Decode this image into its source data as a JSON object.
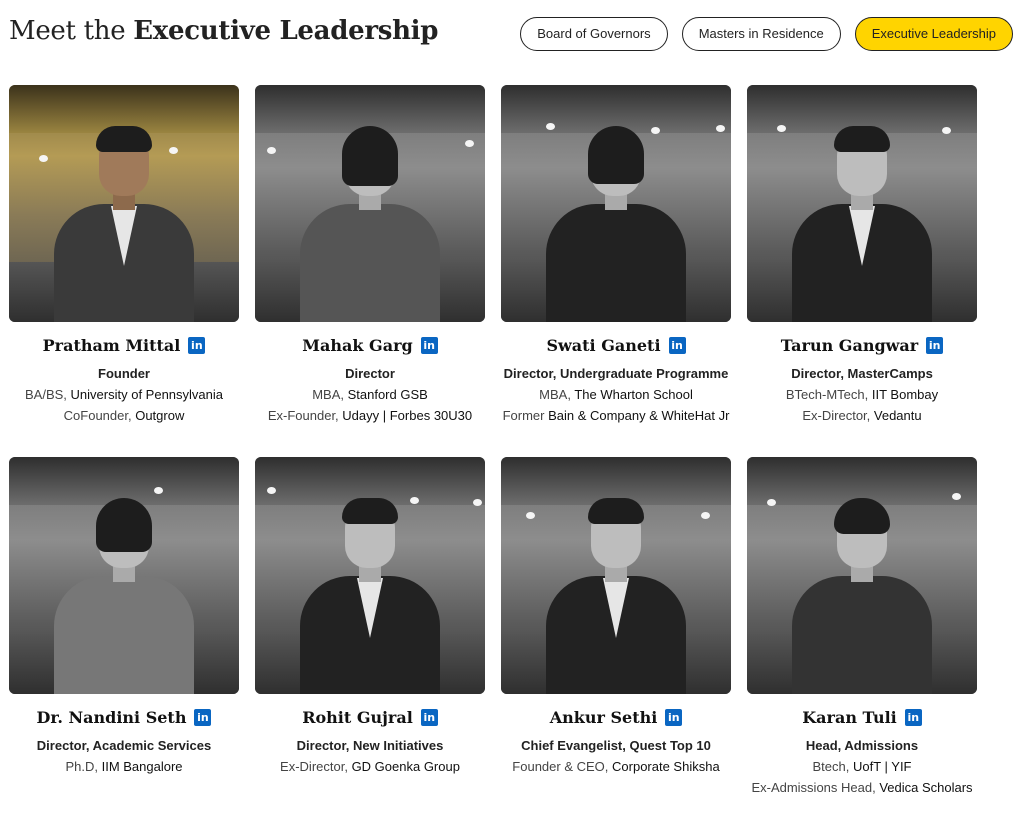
{
  "header": {
    "title_prefix": "Meet the ",
    "title_bold": "Executive Leadership",
    "tabs": [
      {
        "label": "Board of Governors",
        "active": false
      },
      {
        "label": "Masters in Residence",
        "active": false
      },
      {
        "label": "Executive Leadership",
        "active": true
      }
    ]
  },
  "colors": {
    "accent": "#FFD400",
    "linkedin": "#0A66C2",
    "text": "#1A1A1A"
  },
  "icons": {
    "linkedin": "linkedin-icon"
  },
  "leaders": [
    {
      "name": "Pratham Mittal",
      "role": "Founder",
      "line1_pre": "BA/BS, ",
      "line1_org": "University of Pennsylvania",
      "line2_pre": "CoFounder, ",
      "line2_org": "Outgrow"
    },
    {
      "name": "Mahak Garg",
      "role": "Director",
      "line1_pre": "MBA, ",
      "line1_org": "Stanford GSB",
      "line2_pre": "Ex-Founder, ",
      "line2_org": "Udayy | Forbes 30U30"
    },
    {
      "name": "Swati Ganeti",
      "role": "Director, Undergraduate Programme",
      "line1_pre": "MBA, ",
      "line1_org": "The Wharton School",
      "line2_pre": "Former ",
      "line2_org": "Bain & Company & WhiteHat Jr"
    },
    {
      "name": "Tarun Gangwar",
      "role": "Director, MasterCamps",
      "line1_pre": "BTech-MTech, ",
      "line1_org": "IIT Bombay",
      "line2_pre": "Ex-Director, ",
      "line2_org": "Vedantu"
    },
    {
      "name": "Dr. Nandini Seth",
      "role": "Director, Academic Services",
      "line1_pre": "Ph.D, ",
      "line1_org": "IIM Bangalore"
    },
    {
      "name": "Rohit Gujral",
      "role": "Director, New Initiatives",
      "line1_pre": "Ex-Director, ",
      "line1_org": "GD Goenka Group"
    },
    {
      "name": "Ankur Sethi",
      "role": "Chief Evangelist, Quest Top 10",
      "line1_pre": "Founder & CEO, ",
      "line1_org": "Corporate Shiksha"
    },
    {
      "name": "Karan Tuli",
      "role": "Head, Admissions",
      "line1_pre": "Btech, ",
      "line1_org": "UofT | YIF",
      "line2_pre": "Ex-Admissions Head, ",
      "line2_org": "Vedica Scholars"
    }
  ]
}
